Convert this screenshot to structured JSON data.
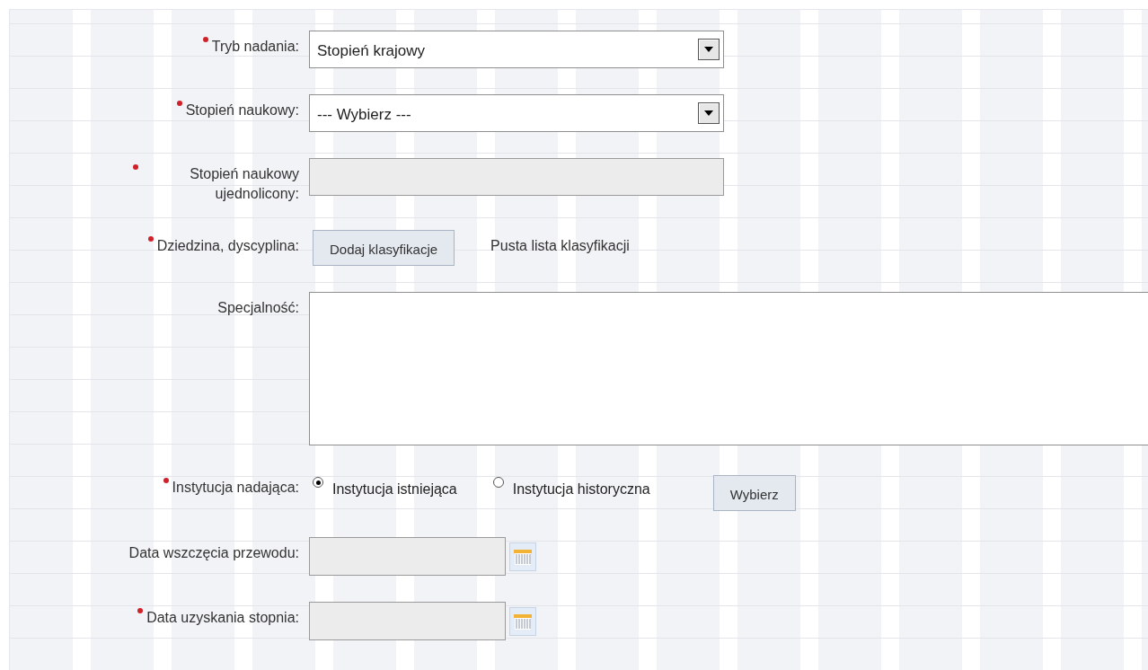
{
  "form": {
    "fields": [
      {
        "kind": "select",
        "label": "Tryb nadania:",
        "required": true,
        "value": "Stopień krajowy"
      },
      {
        "kind": "select",
        "label": "Stopień naukowy:",
        "required": true,
        "value": "--- Wybierz ---"
      },
      {
        "kind": "readonly",
        "label": "Stopień naukowy ujednolicony:",
        "required": true
      },
      {
        "kind": "classification",
        "label": "Dziedzina, dyscyplina:",
        "required": true,
        "button": "Dodaj klasyfikacje",
        "note": "Pusta lista klasyfikacji"
      },
      {
        "kind": "textarea",
        "label": "Specjalność:",
        "required": false
      },
      {
        "kind": "radio",
        "label": "Instytucja nadająca:",
        "required": true,
        "options": [
          {
            "label": "Instytucja istniejąca",
            "selected": true
          },
          {
            "label": "Instytucja historyczna",
            "selected": false
          }
        ],
        "button": "Wybierz"
      },
      {
        "kind": "date",
        "label": "Data wszczęcia przewodu:",
        "required": false
      },
      {
        "kind": "date",
        "label": "Data uzyskania stopnia:",
        "required": true
      }
    ]
  }
}
